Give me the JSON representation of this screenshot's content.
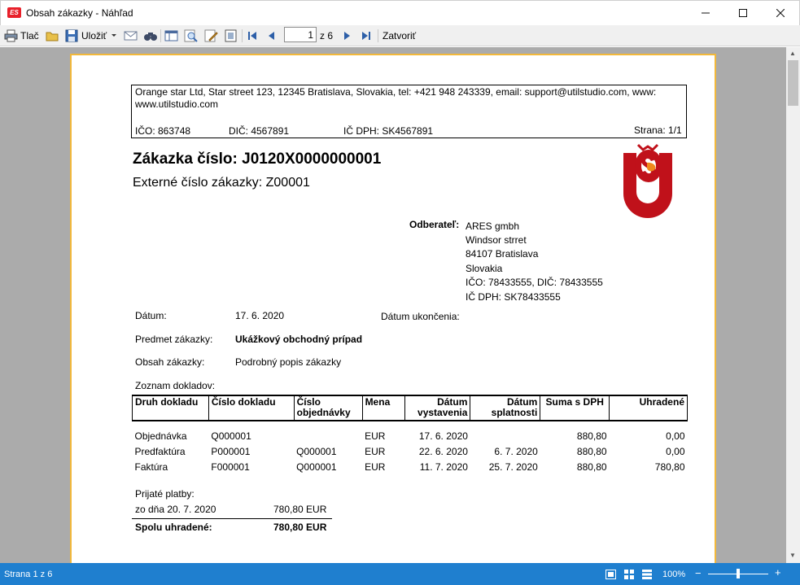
{
  "window": {
    "title": "Obsah zákazky - Náhľad",
    "icon_text": "ES"
  },
  "toolbar": {
    "print_label": "Tlač",
    "save_label": "Uložiť",
    "page_value": "1",
    "page_of": "z 6",
    "close_label": "Zatvoriť"
  },
  "header": {
    "company_line": "Orange star Ltd, Star street 123, 12345 Bratislava, Slovakia, tel: +421 948 243339, email: support@utilstudio.com, www:",
    "company_web": "www.utilstudio.com",
    "ico": "IČO: 863748",
    "dic": "DIČ: 4567891",
    "ic_dph": "IČ DPH: SK4567891",
    "page": "Strana: 1/1"
  },
  "order": {
    "title": "Zákazka číslo: J0120X0000000001",
    "external": "Externé číslo zákazky: Z00001"
  },
  "customer": {
    "label": "Odberateľ:",
    "lines": [
      "ARES gmbh",
      "Windsor strret",
      "84107 Bratislava",
      "Slovakia",
      "IČO: 78433555, DIČ: 78433555",
      "IČ DPH: SK78433555"
    ]
  },
  "details": {
    "date_label": "Dátum:",
    "date_value": "17. 6. 2020",
    "end_date_label": "Dátum ukončenia:",
    "subject_label": "Predmet zákazky:",
    "subject_value": "Ukážkový obchodný prípad",
    "content_label": "Obsah zákazky:",
    "content_value": "Podrobný popis zákazky",
    "docs_label": "Zoznam dokladov:"
  },
  "documents": {
    "columns": [
      "Druh dokladu",
      "Číslo dokladu",
      "Číslo objednávky",
      "Mena",
      "Dátum vystavenia",
      "Dátum splatnosti",
      "Suma s DPH",
      "Uhradené"
    ],
    "rows": [
      [
        "Objednávka",
        "Q000001",
        "",
        "EUR",
        "17. 6. 2020",
        "",
        "880,80",
        "0,00"
      ],
      [
        "Predfaktúra",
        "P000001",
        "Q000001",
        "EUR",
        "22. 6. 2020",
        "6. 7. 2020",
        "880,80",
        "0,00"
      ],
      [
        "Faktúra",
        "F000001",
        "Q000001",
        "EUR",
        "11. 7. 2020",
        "25. 7. 2020",
        "880,80",
        "780,80"
      ]
    ]
  },
  "payments": {
    "label": "Prijaté platby:",
    "line_label": "zo dňa 20. 7. 2020",
    "line_value": "780,80 EUR",
    "total_label": "Spolu uhradené:",
    "total_value": "780,80 EUR"
  },
  "status": {
    "page_text": "Strana 1 z 6",
    "zoom": "100%",
    "zoom_level": 0.5
  },
  "colors": {
    "statusbar": "#1f7fcf",
    "page_border": "#f2b83a",
    "logo_red": "#c0111a",
    "logo_orange": "#f08a1c",
    "preview_bg": "#ababab"
  }
}
